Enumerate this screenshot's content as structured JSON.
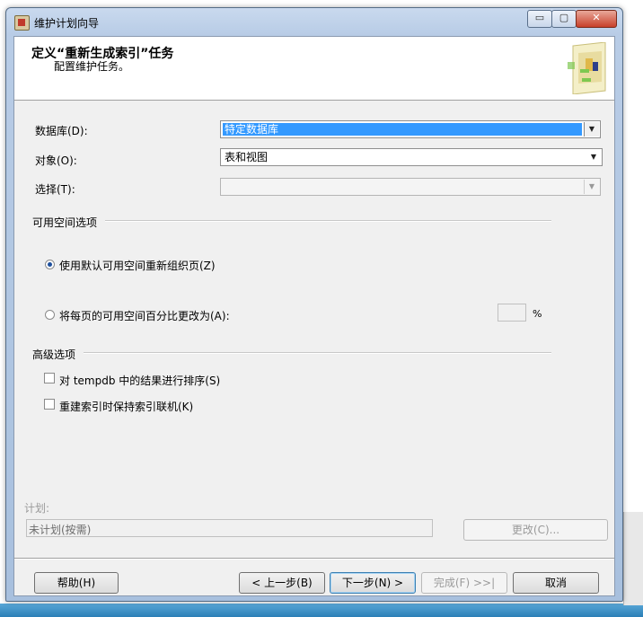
{
  "window": {
    "title": "维护计划向导",
    "controls": {
      "minimize": "▭",
      "maximize": "▢",
      "close": "✕"
    }
  },
  "header": {
    "title": "定义“重新生成索引”任务",
    "subtitle": "配置维护任务。"
  },
  "form": {
    "database_label": "数据库(D):",
    "database_value": "特定数据库",
    "object_label": "对象(O):",
    "object_value": "表和视图",
    "selection_label": "选择(T):",
    "selection_value": ""
  },
  "free_space": {
    "group_title": "可用空间选项",
    "default_option": "使用默认可用空间重新组织页(Z)",
    "percent_option": "将每页的可用空间百分比更改为(A):",
    "percent_unit": "%",
    "default_selected": true
  },
  "advanced": {
    "group_title": "高级选项",
    "sort_tempdb": "对 tempdb 中的结果进行排序(S)",
    "keep_online": "重建索引时保持索引联机(K)"
  },
  "schedule": {
    "label": "计划:",
    "value": "未计划(按需)",
    "change_button": "更改(C)..."
  },
  "buttons": {
    "help": "帮助(H)",
    "back": "< 上一步(B)",
    "next": "下一步(N) >",
    "finish": "完成(F) >>|",
    "cancel": "取消"
  },
  "icons": {
    "app": "maintenance-plan-icon",
    "header": "wizard-graphic-icon",
    "dropdown": "chevron-down-icon"
  }
}
